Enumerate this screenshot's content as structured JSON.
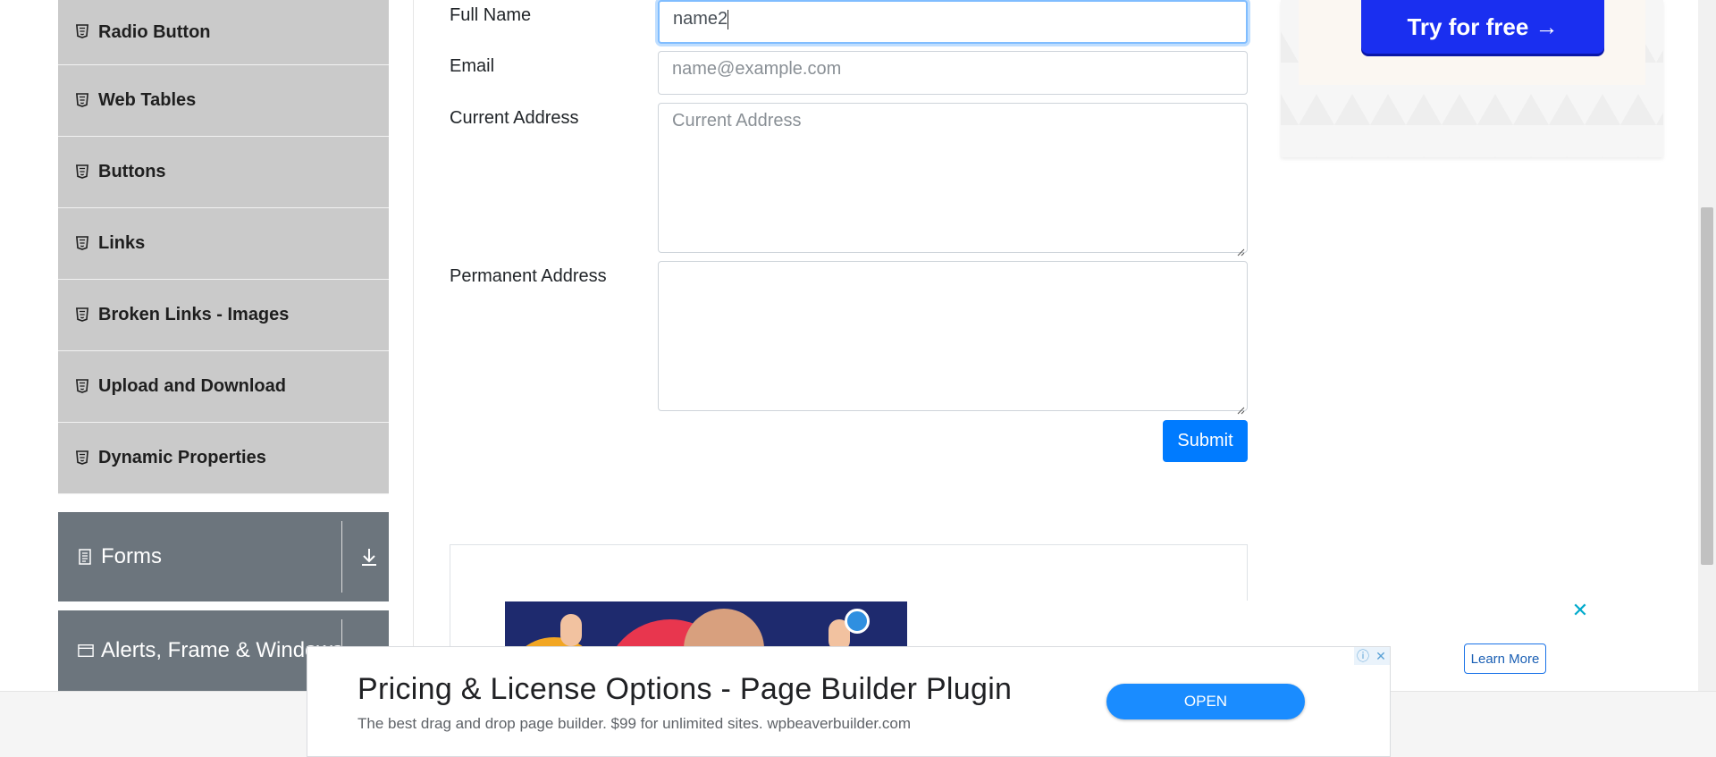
{
  "sidebar": {
    "items": [
      {
        "label": "Radio Button",
        "icon": "html-icon"
      },
      {
        "label": "Web Tables",
        "icon": "html-icon"
      },
      {
        "label": "Buttons",
        "icon": "html-icon"
      },
      {
        "label": "Links",
        "icon": "html-icon"
      },
      {
        "label": "Broken Links - Images",
        "icon": "html-icon"
      },
      {
        "label": "Upload and Download",
        "icon": "html-icon"
      },
      {
        "label": "Dynamic Properties",
        "icon": "html-icon"
      }
    ],
    "groups": [
      {
        "label": "Forms",
        "icon": "document-icon"
      },
      {
        "label": "Alerts, Frame & Windows",
        "icon": "window-icon"
      }
    ]
  },
  "form": {
    "full_name_label": "Full Name",
    "full_name_value": "name2",
    "email_label": "Email",
    "email_placeholder": "name@example.com",
    "current_address_label": "Current Address",
    "current_address_placeholder": "Current Address",
    "permanent_address_label": "Permanent Address",
    "submit_label": "Submit"
  },
  "ads": {
    "try_free_label": "Try for free →",
    "learn_more_label": "Learn More",
    "close_symbol": "✕",
    "banner_title": "Pricing & License Options - Page Builder Plugin",
    "banner_desc": "The best drag and drop page builder. $99 for unlimited sites. wpbeaverbuilder.com",
    "banner_open_label": "OPEN",
    "adchoice_info": "ⓘ",
    "adchoice_close": "✕"
  },
  "colors": {
    "accent": "#007bff",
    "sidebar_item_bg": "#cacaca",
    "group_bg": "#6c757d",
    "try_button": "#1a2ff0"
  }
}
